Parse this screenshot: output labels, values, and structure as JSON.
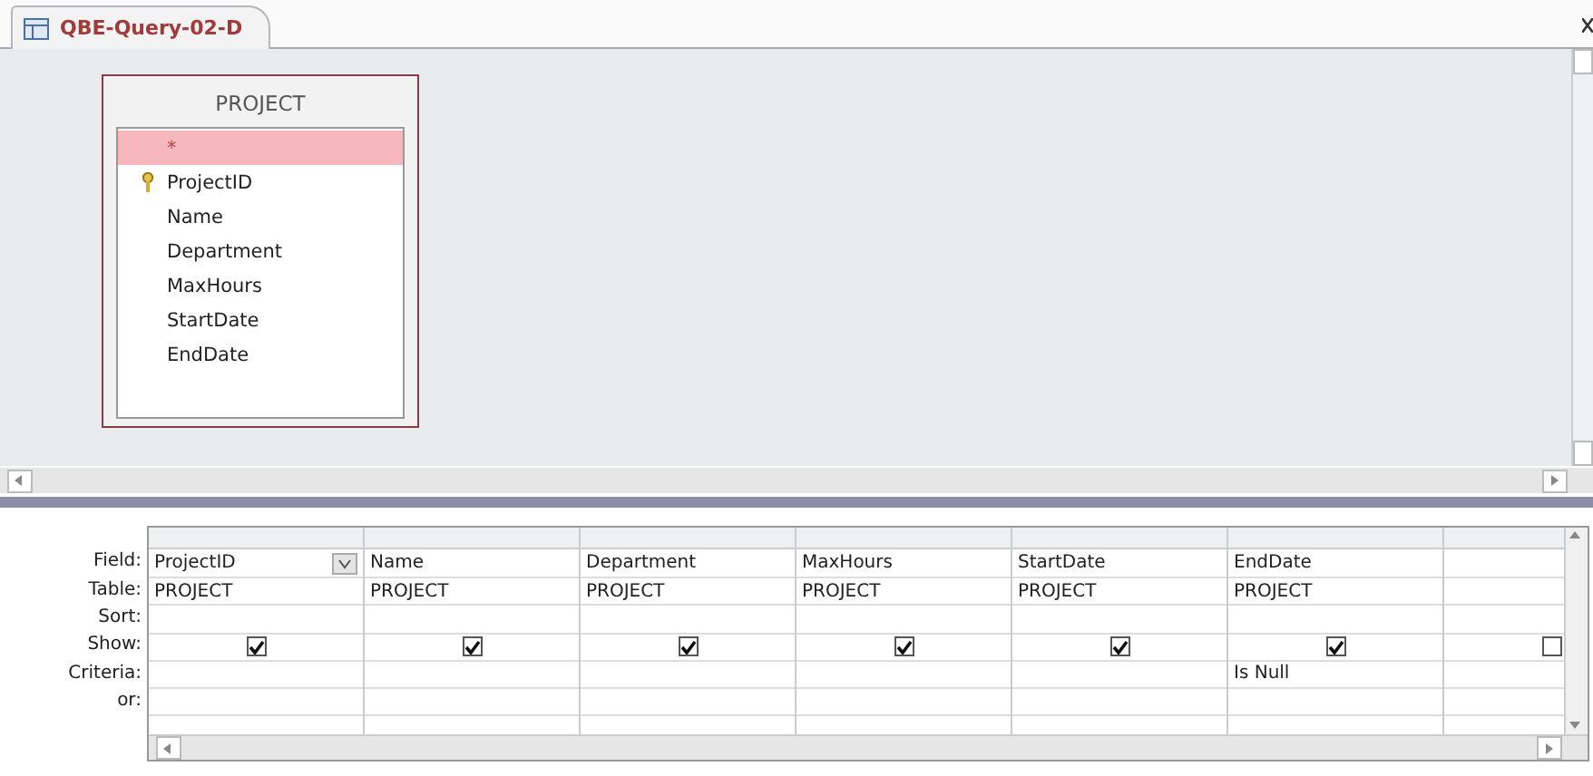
{
  "tab": {
    "title": "QBE-Query-02-D",
    "selected": true
  },
  "table_box": {
    "title": "PROJECT",
    "fields": [
      {
        "name": "*",
        "key": false,
        "selected": true
      },
      {
        "name": "ProjectID",
        "key": true,
        "selected": false
      },
      {
        "name": "Name",
        "key": false,
        "selected": false
      },
      {
        "name": "Department",
        "key": false,
        "selected": false
      },
      {
        "name": "MaxHours",
        "key": false,
        "selected": false
      },
      {
        "name": "StartDate",
        "key": false,
        "selected": false
      },
      {
        "name": "EndDate",
        "key": false,
        "selected": false
      }
    ]
  },
  "grid": {
    "row_labels": [
      "Field:",
      "Table:",
      "Sort:",
      "Show:",
      "Criteria:",
      "or:"
    ],
    "columns": [
      {
        "field": "ProjectID",
        "table": "PROJECT",
        "show": true,
        "dropdown": true
      },
      {
        "field": "Name",
        "table": "PROJECT",
        "show": true,
        "dropdown": false
      },
      {
        "field": "Department",
        "table": "PROJECT",
        "show": true,
        "dropdown": false
      },
      {
        "field": "MaxHours",
        "table": "PROJECT",
        "show": true,
        "dropdown": false
      },
      {
        "field": "StartDate",
        "table": "PROJECT",
        "show": true,
        "dropdown": false
      },
      {
        "field": "EndDate",
        "table": "PROJECT",
        "show": true,
        "criteria": "Is Null",
        "dropdown": false
      },
      {
        "show": false,
        "dropdown": false
      }
    ]
  }
}
